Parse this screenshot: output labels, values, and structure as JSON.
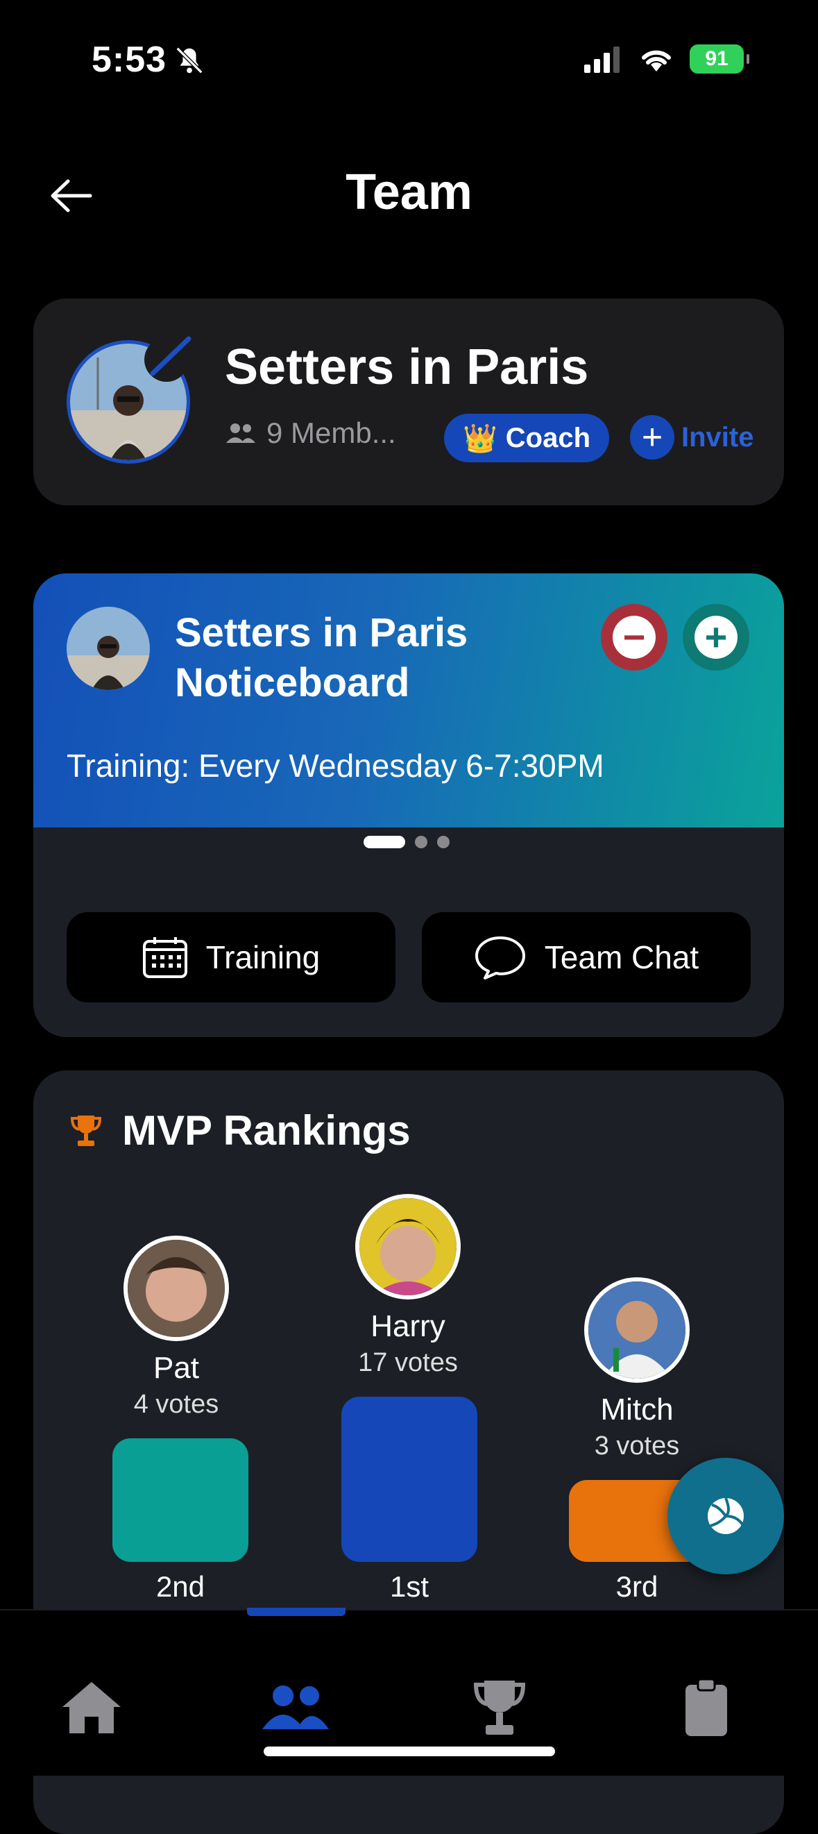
{
  "status": {
    "time": "5:53",
    "battery": "91"
  },
  "header": {
    "title": "Team"
  },
  "team": {
    "name": "Setters in Paris",
    "members": "9 Memb...",
    "coach_label": "Coach",
    "coach_emoji": "👑",
    "invite_label": "Invite"
  },
  "notice": {
    "title": "Setters in Paris Noticeboard",
    "text": "Training: Every Wednesday 6-7:30PM",
    "minus": "−",
    "plus": "+"
  },
  "actions": {
    "training": "Training",
    "chat": "Team Chat"
  },
  "mvp": {
    "title": "MVP Rankings",
    "players": [
      {
        "name": "Pat",
        "votes": "4 votes",
        "rank": "2nd",
        "color": "#0a9f94"
      },
      {
        "name": "Harry",
        "votes": "17 votes",
        "rank": "1st",
        "color": "#1547b8"
      },
      {
        "name": "Mitch",
        "votes": "3 votes",
        "rank": "3rd",
        "color": "#e8720c"
      }
    ]
  },
  "colors": {
    "accent": "#1547b8",
    "teal": "#0a9f94",
    "orange": "#e8720c",
    "danger": "#a9303a"
  }
}
